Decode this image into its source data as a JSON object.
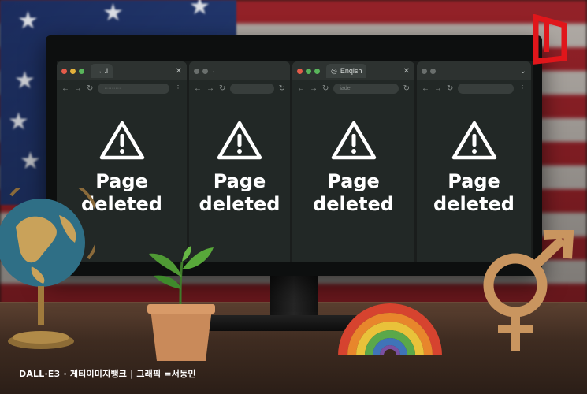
{
  "windows": [
    {
      "tab_label": "→ .l",
      "address": "·········",
      "message_line1": "Page",
      "message_line2": "deleted"
    },
    {
      "tab_label": "←",
      "address": "",
      "message_line1": "Page",
      "message_line2": "deleted"
    },
    {
      "tab_label": "Enqish",
      "address": "iade",
      "message_line1": "Page",
      "message_line2": "deleted"
    },
    {
      "tab_label": "",
      "address": "",
      "message_line1": "Page",
      "message_line2": "deleted"
    }
  ],
  "credit": "DALL·E3 · 게티이미지뱅크  | 그래픽 =서동민",
  "icons": {
    "warning": "warning-triangle-icon",
    "cursor": "mouse-pointer-icon",
    "logo": "red-bracket-logo",
    "gender": "male-female-symbol"
  },
  "colors": {
    "screen": "#222826",
    "message": "#ffffff",
    "logo": "#e0161b"
  }
}
